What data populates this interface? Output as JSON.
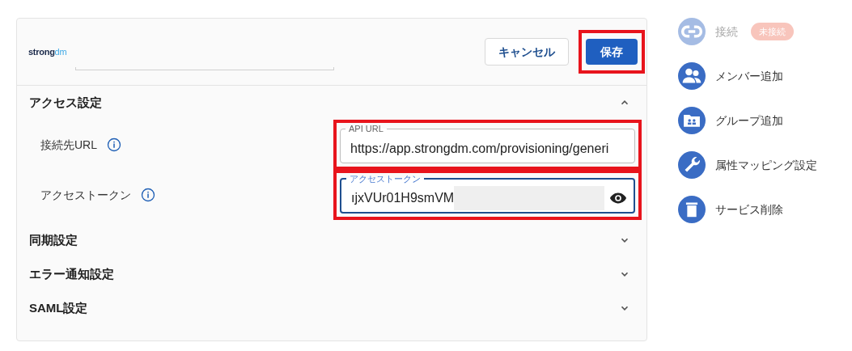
{
  "header": {
    "logo": {
      "main": "strong",
      "accent": "dm"
    },
    "buttons": [
      {
        "label": "キャンセル",
        "kind": "outline",
        "highlighted": false
      },
      {
        "label": "保存",
        "kind": "primary",
        "highlighted": true
      }
    ]
  },
  "sections": [
    {
      "title": "アクセス設定",
      "expanded": true,
      "fields": [
        {
          "label": "接続先URL",
          "field_label": "API URL",
          "value": "https://app.strongdm.com/provisioning/generi",
          "focused": false,
          "highlighted": true,
          "masked": false
        },
        {
          "label": "アクセストークン",
          "field_label": "アクセストークン",
          "value": "ıjxVUr01H9smVM",
          "focused": true,
          "highlighted": true,
          "masked": true
        }
      ]
    },
    {
      "title": "同期設定",
      "expanded": false
    },
    {
      "title": "エラー通知設定",
      "expanded": false
    },
    {
      "title": "SAML設定",
      "expanded": false
    }
  ],
  "sidebar": {
    "items": [
      {
        "label": "接続",
        "kind": "link",
        "disabled": true,
        "badge": "未接続"
      },
      {
        "label": "メンバー追加",
        "kind": "members",
        "disabled": false
      },
      {
        "label": "グループ追加",
        "kind": "group",
        "disabled": false
      },
      {
        "label": "属性マッピング設定",
        "kind": "wrench",
        "disabled": false
      },
      {
        "label": "サービス削除",
        "kind": "trash",
        "disabled": false
      }
    ]
  }
}
